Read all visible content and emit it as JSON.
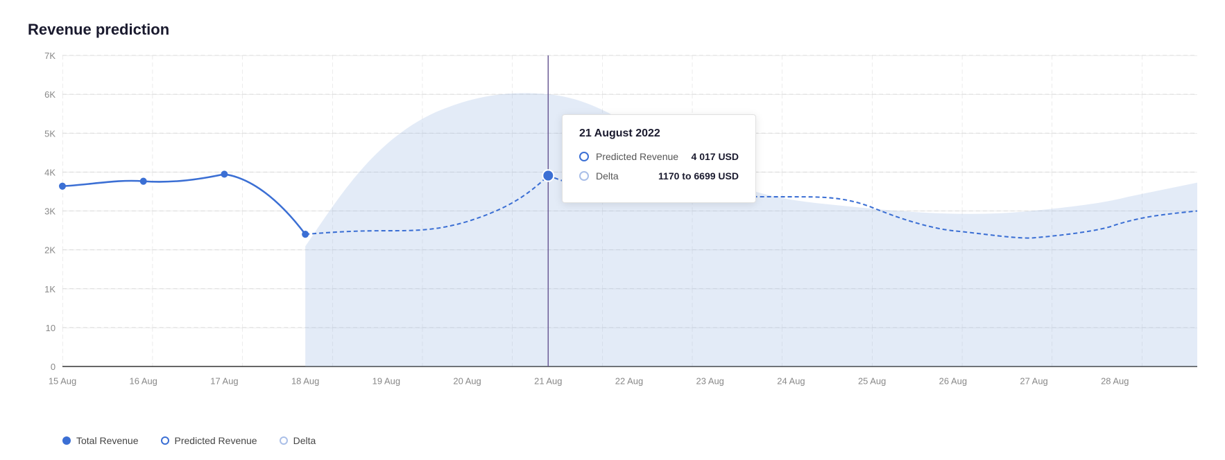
{
  "title": "Revenue prediction",
  "chart": {
    "yAxis": {
      "labels": [
        "7K",
        "6K",
        "5K",
        "4K",
        "3K",
        "2K",
        "1K",
        "10",
        "0"
      ]
    },
    "xAxis": {
      "labels": [
        "15 Aug",
        "16 Aug",
        "17 Aug",
        "18 Aug",
        "19 Aug",
        "20 Aug",
        "21 Aug",
        "22 Aug",
        "23 Aug",
        "24 Aug",
        "25 Aug",
        "26 Aug",
        "27 Aug",
        "28 Aug"
      ]
    },
    "tooltip": {
      "date": "21 August 2022",
      "predicted_revenue_label": "Predicted Revenue",
      "predicted_revenue_value": "4 017 USD",
      "delta_label": "Delta",
      "delta_value": "1170 to 6699 USD"
    }
  },
  "legend": {
    "items": [
      {
        "label": "Total Revenue",
        "type": "solid-dot"
      },
      {
        "label": "Predicted Revenue",
        "type": "outline-dot"
      },
      {
        "label": "Delta",
        "type": "outline-dot-light"
      }
    ]
  },
  "colors": {
    "blue": "#3b6fd4",
    "blue_light": "#aabfe8",
    "blue_area": "rgba(163,190,230,0.35)",
    "tooltip_border": "#e0e0e0",
    "grid": "#d0d0d0",
    "vertical_line": "#6b5b95"
  }
}
